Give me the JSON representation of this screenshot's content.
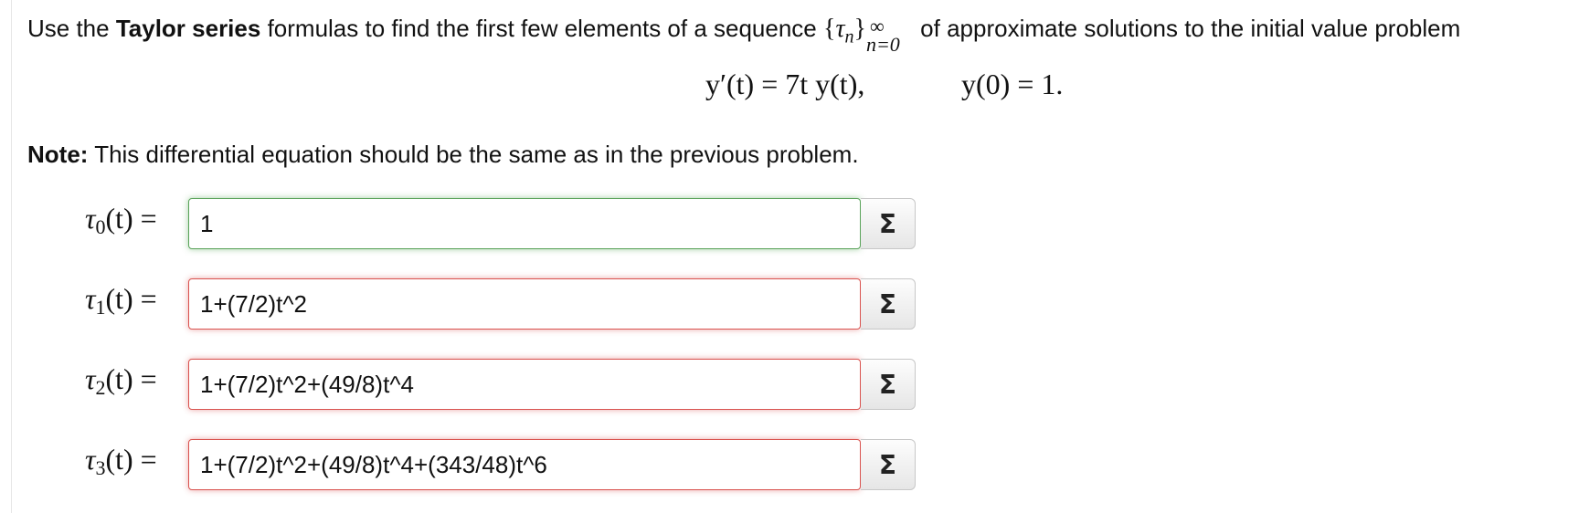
{
  "intro": {
    "lead": "Use the ",
    "bold": "Taylor series",
    "middle": " formulas to find the first few elements of a sequence ",
    "seq_open": "{",
    "seq_var": "τ",
    "seq_var_sub": "n",
    "seq_close": "}",
    "seq_sup": "∞",
    "seq_sub": "n=0",
    "tail": " of approximate solutions to the initial value problem"
  },
  "equation": {
    "main": "y′(t) = 7t y(t),",
    "initial": "y(0) = 1."
  },
  "note": {
    "label": "Note:",
    "text": " This differential equation should be the same as in the previous problem."
  },
  "rows": [
    {
      "var": "τ",
      "sub": "0",
      "arg": "(t) =",
      "value": "1",
      "status": "correct"
    },
    {
      "var": "τ",
      "sub": "1",
      "arg": "(t) =",
      "value": "1+(7/2)t^2",
      "status": "incorrect"
    },
    {
      "var": "τ",
      "sub": "2",
      "arg": "(t) =",
      "value": "1+(7/2)t^2+(49/8)t^4",
      "status": "incorrect"
    },
    {
      "var": "τ",
      "sub": "3",
      "arg": "(t) =",
      "value": "1+(7/2)t^2+(49/8)t^4+(343/48)t^6",
      "status": "incorrect"
    }
  ],
  "equation_button": {
    "label": "Σ",
    "icon": "sigma-icon"
  },
  "colors": {
    "correct": "#5aa35a",
    "incorrect": "#d9534f"
  }
}
